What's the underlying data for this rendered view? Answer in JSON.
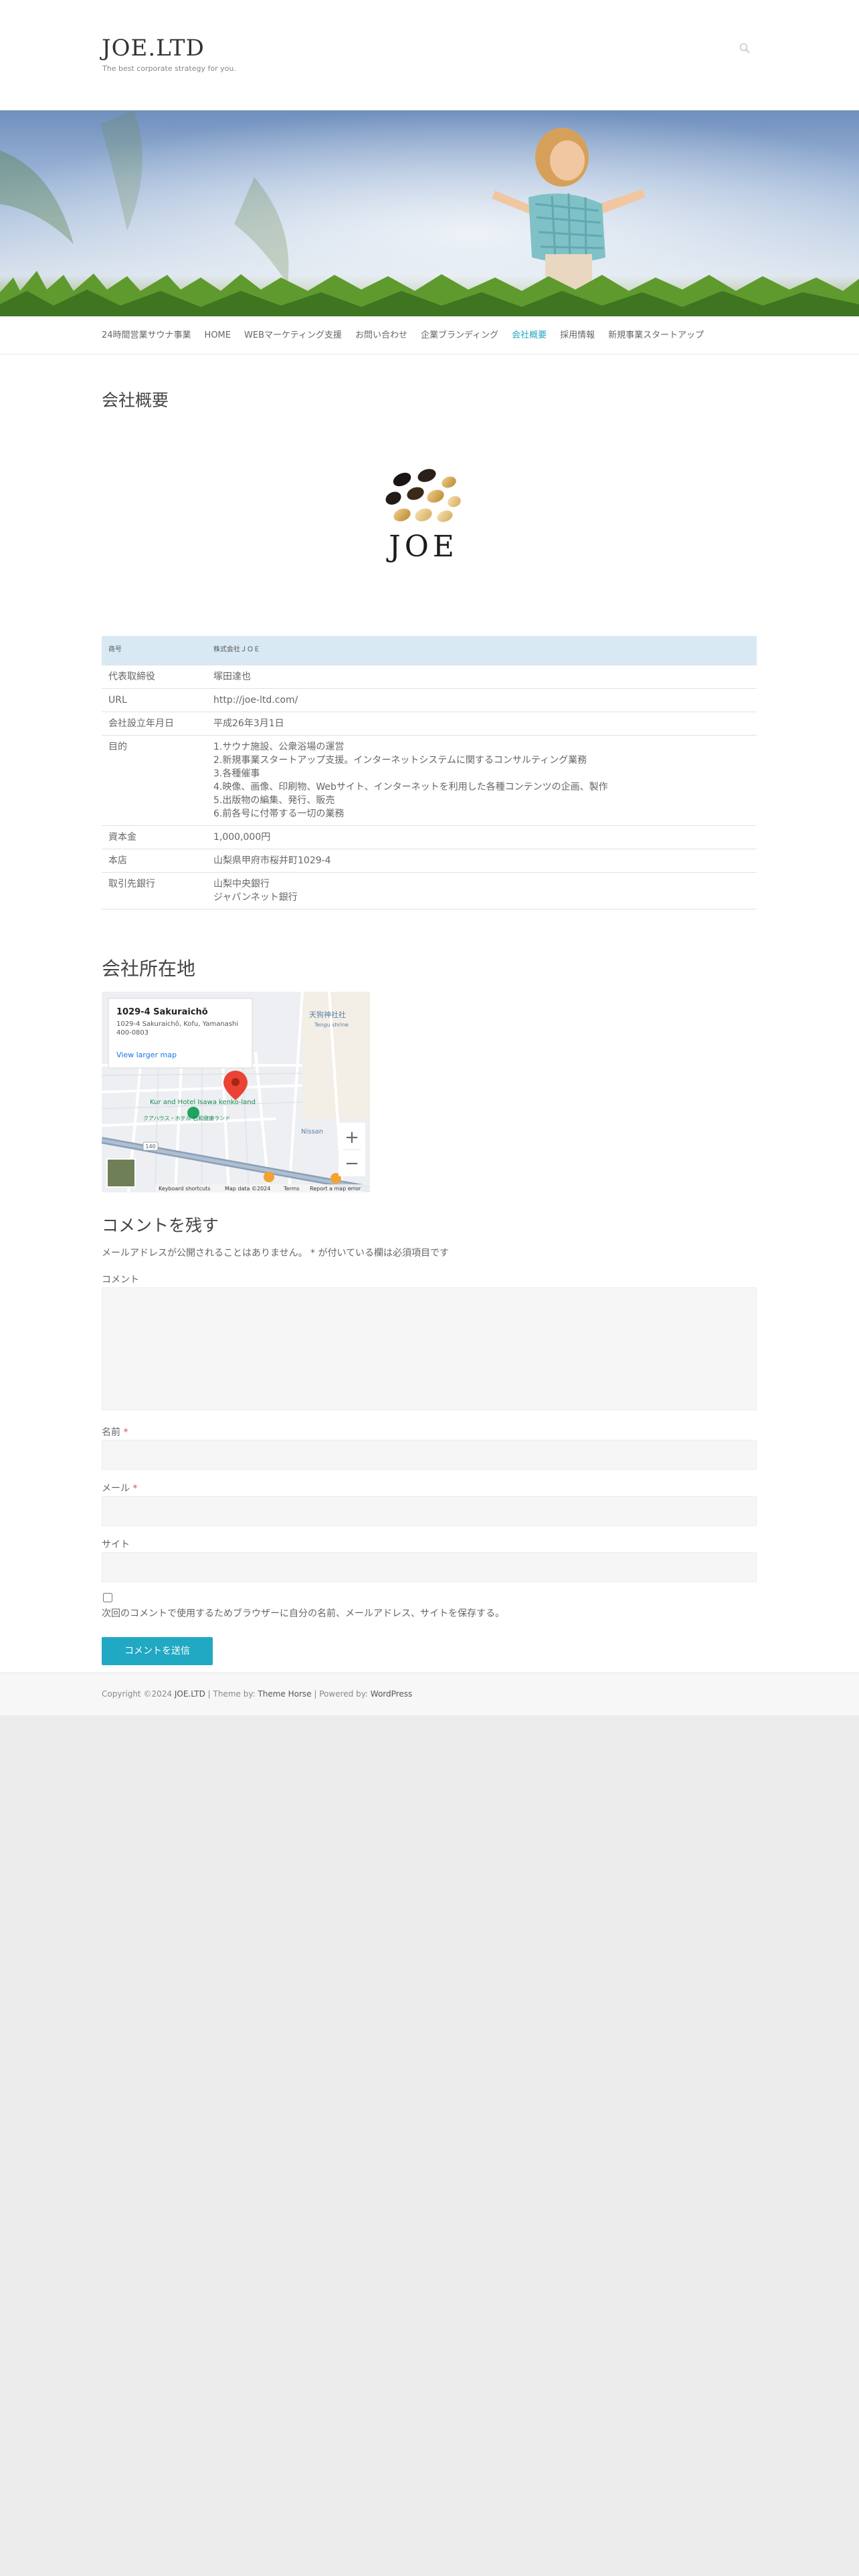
{
  "header": {
    "site_title": "JOE.LTD",
    "tagline": "The best corporate strategy for you."
  },
  "nav": {
    "items": [
      {
        "label": "24時間営業サウナ事業",
        "current": false
      },
      {
        "label": "HOME",
        "current": false
      },
      {
        "label": "WEBマーケティング支援",
        "current": false
      },
      {
        "label": "お問い合わせ",
        "current": false
      },
      {
        "label": "企業ブランディング",
        "current": false
      },
      {
        "label": "会社概要",
        "current": true
      },
      {
        "label": "採用情報",
        "current": false
      },
      {
        "label": "新規事業スタートアップ",
        "current": false
      }
    ],
    "accent": "#21a8c3"
  },
  "content": {
    "heading": "会社概要",
    "logo_text": "JOE",
    "table": {
      "header": {
        "k": "商号",
        "v": "株式会社ＪＯＥ"
      },
      "rows": [
        {
          "k": "代表取締役",
          "v": "塚田達也"
        },
        {
          "k": "URL",
          "v": "http://joe-ltd.com/"
        },
        {
          "k": "会社設立年月日",
          "v": "平成26年3月1日"
        },
        {
          "k": "目的",
          "v": "1.サウナ施設、公衆浴場の運営\n2.新規事業スタートアップ支援。インターネットシステムに関するコンサルティング業務\n3.各種催事\n4.映像、画像、印刷物、Webサイト、インターネットを利用した各種コンテンツの企画、製作\n5.出版物の編集、発行、販売\n6.前各号に付帯する一切の業務"
        },
        {
          "k": "資本金",
          "v": "1,000,000円"
        },
        {
          "k": "本店",
          "v": "山梨県甲府市桜井町1029-4"
        },
        {
          "k": "取引先銀行",
          "v": "山梨中央銀行\nジャパンネット銀行"
        }
      ]
    }
  },
  "location": {
    "heading": "会社所在地",
    "map": {
      "card_title": "1029-4 Sakuraichō",
      "card_address": "1029-4 Sakuraichō, Kofu, Yamanashi 400-0803",
      "card_link": "View larger map",
      "place_1": "Kur and Hotel Isawa kenko-land",
      "place_1_sub": "クアハウス・ホテル 石和健康ランド",
      "place_2": "天狗神社社",
      "place_2_sub": "Tengu shrine",
      "place_3": "Nissan",
      "road_label": "140",
      "attribution": [
        "Keyboard shortcuts",
        "Map data ©2024",
        "Terms",
        "Report a map error"
      ],
      "zoom_in": "+",
      "zoom_out": "−"
    }
  },
  "comment": {
    "heading": "コメントを残す",
    "note": "メールアドレスが公開されることはありません。 * が付いている欄は必須項目です",
    "comment_label": "コメント",
    "name_label": "名前",
    "email_label": "メール",
    "site_label": "サイト",
    "required_mark": "*",
    "cookie_label": "次回のコメントで使用するためブラウザーに自分の名前、メールアドレス、サイトを保存する。",
    "submit_label": "コメントを送信"
  },
  "footer": {
    "copyright": "Copyright ©2024",
    "site_link": "JOE.LTD",
    "theme_prefix": "| Theme by:",
    "theme_link": "Theme Horse",
    "powered_prefix": "| Powered by:",
    "powered_link": "WordPress"
  }
}
